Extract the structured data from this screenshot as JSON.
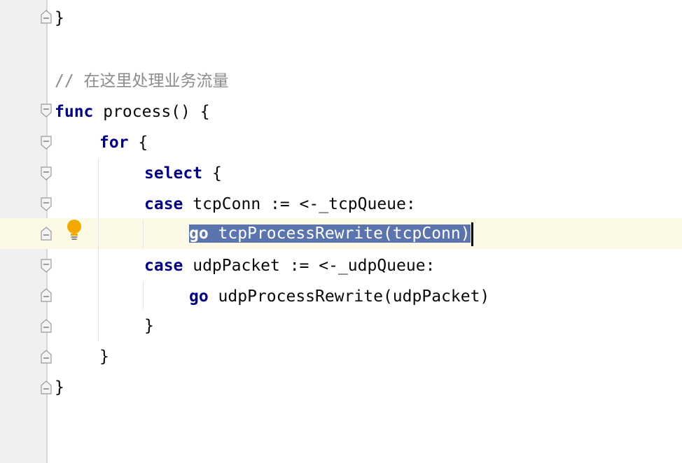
{
  "editor": {
    "language": "go",
    "lines": {
      "l1": {
        "brace": "}"
      },
      "l2": {
        "comment": "// 在这里处理业务流量"
      },
      "l3": {
        "kw": "func",
        "rest": " process() {"
      },
      "l4": {
        "kw": "for",
        "rest": " {"
      },
      "l5": {
        "kw": "select",
        "rest": " {"
      },
      "l6": {
        "kw": "case",
        "rest": " tcpConn := <-_tcpQueue:"
      },
      "l7": {
        "kw": "go",
        "rest": " tcpProcessRewrite(tcpConn)"
      },
      "l8": {
        "kw": "case",
        "rest": " udpPacket := <-_udpQueue:"
      },
      "l9": {
        "kw": "go",
        "rest": " udpProcessRewrite(udpPacket)"
      },
      "l10": {
        "brace": "}"
      },
      "l11": {
        "brace": "}"
      },
      "l12": {
        "brace": "}"
      }
    },
    "selected_text_line": 7,
    "current_line_highlight": "#fcf9e6",
    "selection_color": "#5b74ad",
    "keyword_color": "#000080",
    "comment_color": "#8c8c8c"
  },
  "gutter": {
    "intention_icon": "lightbulb-icon",
    "fold_icon": "fold-marker-icon"
  }
}
